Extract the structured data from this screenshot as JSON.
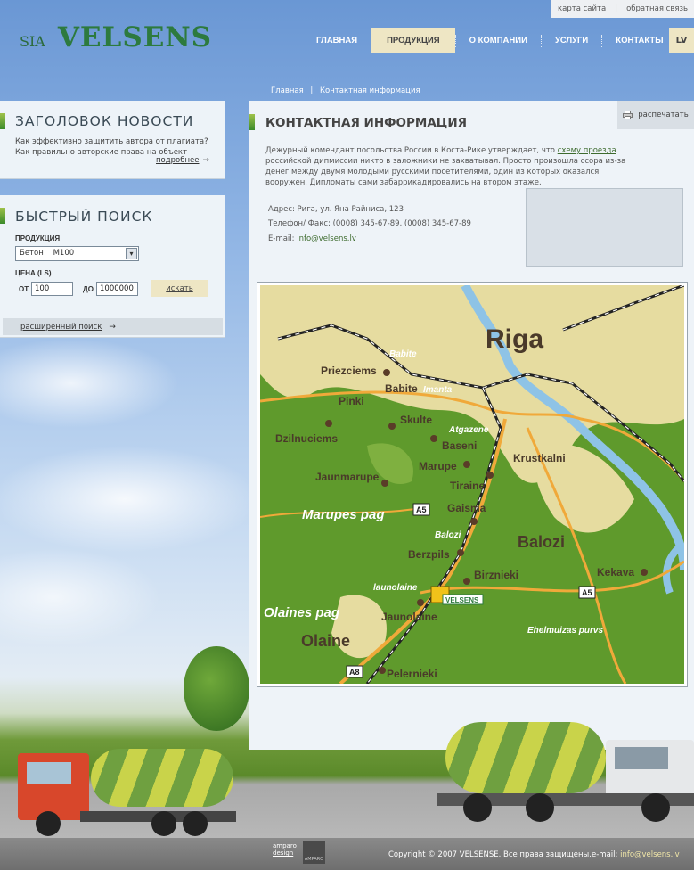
{
  "top_links": {
    "sitemap": "карта сайта",
    "separator": "|",
    "feedback": "обратная связь"
  },
  "logo": {
    "prefix": "SIA",
    "name": "VELSENS"
  },
  "nav": {
    "items": [
      "ГЛАВНАЯ",
      "ПРОДУКЦИЯ",
      "О КОМПАНИИ",
      "УСЛУГИ",
      "КОНТАКТЫ"
    ],
    "active": "ПРОДУКЦИЯ",
    "language": "LV"
  },
  "breadcrumb": {
    "home": "Главная",
    "separator": "|",
    "current": "Контактная информация"
  },
  "news": {
    "title": "ЗАГОЛОВОК НОВОСТИ",
    "text": "Как эффективно защитить автора от плагиата? Как правильно авторские права на объект",
    "more": "подробнее",
    "arrow": "→"
  },
  "search": {
    "title": "БЫСТРЫЙ ПОИСК",
    "product_label": "ПРОДУКЦИЯ",
    "product_value": "Бетон    М100",
    "dropdown_arrow": "▾",
    "price_label": "ЦЕНА (LS)",
    "from_label": "ОТ",
    "from_value": "100",
    "to_label": "ДО",
    "to_value": "1000000",
    "button": "искать",
    "advanced": "расширенный поиск",
    "arrow": "→"
  },
  "main": {
    "title": "КОНТАКТНАЯ ИНФОРМАЦИЯ",
    "print": "распечатать",
    "intro_before": "Дежурный комендант посольства России в Коста-Рике утверждает, что ",
    "intro_link": "схему проезда",
    "intro_after": " российской дипмиссии никто в заложники не захватывал. Просто произошла ссора из-за денег между двумя молодыми русскими посетителями, один из которых оказался вооружен. Дипломаты сами забаррикадировались на втором этаже.",
    "address": "Адрес: Рига, ул. Яна Райниса, 123",
    "phone": "Телефон/ Факс: (0008) 345-67-89,  (0008) 345-67-89",
    "email_label": "E-mail: ",
    "email": "info@velsens.lv"
  },
  "map": {
    "labels": [
      "Riga",
      "Babite",
      "Priezciems",
      "Babite",
      "Imanta",
      "Pinki",
      "Skulte",
      "Dzilnuciems",
      "Atgazene",
      "Baseni",
      "Krustkalni",
      "Marupe",
      "Tiraine",
      "Jaunmarupe",
      "Marupes pag",
      "Gaisma",
      "Balozi",
      "Balozi",
      "Berzpils",
      "Birznieki",
      "Kekava",
      "launolaine",
      "VELSENS",
      "Olaines pag",
      "Jaunolaine",
      "Olaine",
      "Ehelmuizas purvs",
      "Pelernieki"
    ],
    "road_labels": [
      "A5",
      "A5",
      "A8"
    ]
  },
  "footer": {
    "amparo_line1": "amparo",
    "amparo_line2": "design",
    "amparo_logo": "AMPARO",
    "copyright": "Copyright © 2007  VELSENSE.  Все права защищены.",
    "email_label": "e-mail: ",
    "email": "info@velsens.lv"
  },
  "colors": {
    "sky": "#6a97d4",
    "accent_beige": "#eee6c4",
    "brand_green": "#2d7a3e",
    "map_green": "#5f9a2c",
    "map_sand": "#e6dca0"
  }
}
